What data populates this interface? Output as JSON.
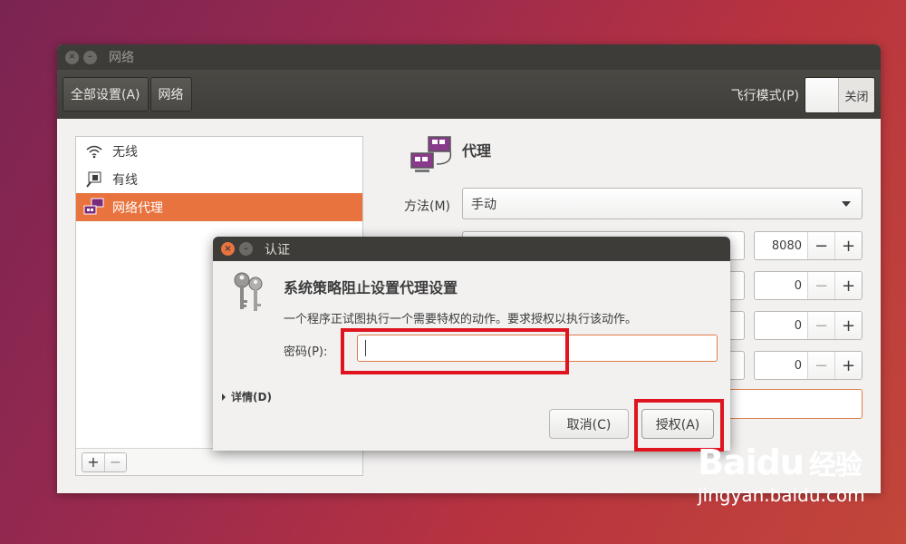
{
  "window": {
    "title": "网络",
    "toolbar": {
      "all_settings": "全部设置(A)",
      "network": "网络"
    },
    "airplane": {
      "label": "飞行模式(P)",
      "state": "关闭"
    }
  },
  "sidebar": {
    "items": [
      {
        "label": "无线",
        "icon": "wifi-icon"
      },
      {
        "label": "有线",
        "icon": "wired-network-icon"
      },
      {
        "label": "网络代理",
        "icon": "network-proxy-icon",
        "active": true
      }
    ],
    "add": "+",
    "remove": "−"
  },
  "proxy": {
    "title": "代理",
    "method_label": "方法(M)",
    "method_value": "手动",
    "ports": [
      {
        "value": "8080",
        "minus": "−",
        "plus": "+"
      },
      {
        "value": "0",
        "minus": "−",
        "plus": "+"
      },
      {
        "value": "0",
        "minus": "−",
        "plus": "+"
      },
      {
        "value": "0",
        "minus": "−",
        "plus": "+"
      }
    ]
  },
  "dialog": {
    "title": "认证",
    "heading": "系统策略阻止设置代理设置",
    "message": "一个程序正试图执行一个需要特权的动作。要求授权以执行该动作。",
    "password_label": "密码(P):",
    "password_value": "",
    "details": "详情(D)",
    "cancel": "取消(C)",
    "authorize": "授权(A)"
  },
  "colors": {
    "accent": "#e8733f",
    "highlight": "#e0141e",
    "titlebar": "#3d3c38"
  },
  "watermark": {
    "logo_text": "Baidu",
    "logo_cn": "经验",
    "url": "jingyan.baidu.com"
  }
}
